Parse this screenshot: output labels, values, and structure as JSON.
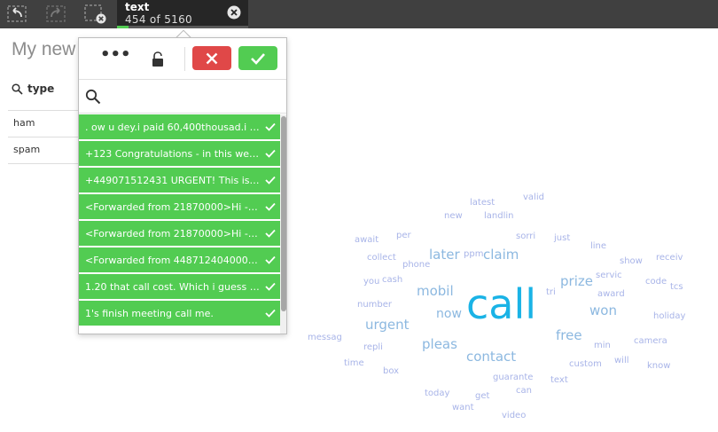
{
  "toolbar": {
    "buttons": [
      {
        "name": "step-back",
        "icon": "step-back-icon"
      },
      {
        "name": "step-forward",
        "icon": "step-forward-icon"
      },
      {
        "name": "clear-all-selections",
        "icon": "clear-selections-icon"
      }
    ],
    "selection": {
      "field": "text",
      "count": "454 of 5160",
      "fraction": 0.088
    }
  },
  "app": {
    "title": "My new"
  },
  "filter_pane": {
    "field_label": "type",
    "values": [
      "ham",
      "spam"
    ]
  },
  "listbox": {
    "more_label": "•••",
    "search_placeholder": "",
    "items": [
      ". ow u dey.i paid 60,400thousad.i tol...",
      "+123 Congratulations - in this week'...",
      "+449071512431 URGENT! This is t...",
      "<Forwarded from 21870000>Hi - t...",
      "<Forwarded from 21870000>Hi - t...",
      "<Forwarded from 448712404000>...",
      "1.20 that call cost. Which i guess isn...",
      "1's finish meeting call me."
    ],
    "colors": {
      "selected": "#52cc52",
      "cancel": "#e04848",
      "confirm": "#52cc52"
    }
  },
  "wordcloud": {
    "words": [
      "call",
      "later",
      "claim",
      "mobil",
      "now",
      "urgent",
      "prize",
      "won",
      "free",
      "pleas",
      "contact",
      "new",
      "latest",
      "valid",
      "landlin",
      "await",
      "per",
      "sorri",
      "just",
      "collect",
      "phone",
      "ppm",
      "line",
      "show",
      "receiv",
      "you",
      "cash",
      "servic",
      "code",
      "tcs",
      "number",
      "tri",
      "award",
      "holiday",
      "messag",
      "repli",
      "min",
      "camera",
      "time",
      "box",
      "custom",
      "will",
      "know",
      "guarante",
      "text",
      "can",
      "today",
      "get",
      "want",
      "video"
    ],
    "colors": {
      "large": "#1ab3e6",
      "medium": "#8cb8e0",
      "small": "#a8b4e8"
    }
  }
}
